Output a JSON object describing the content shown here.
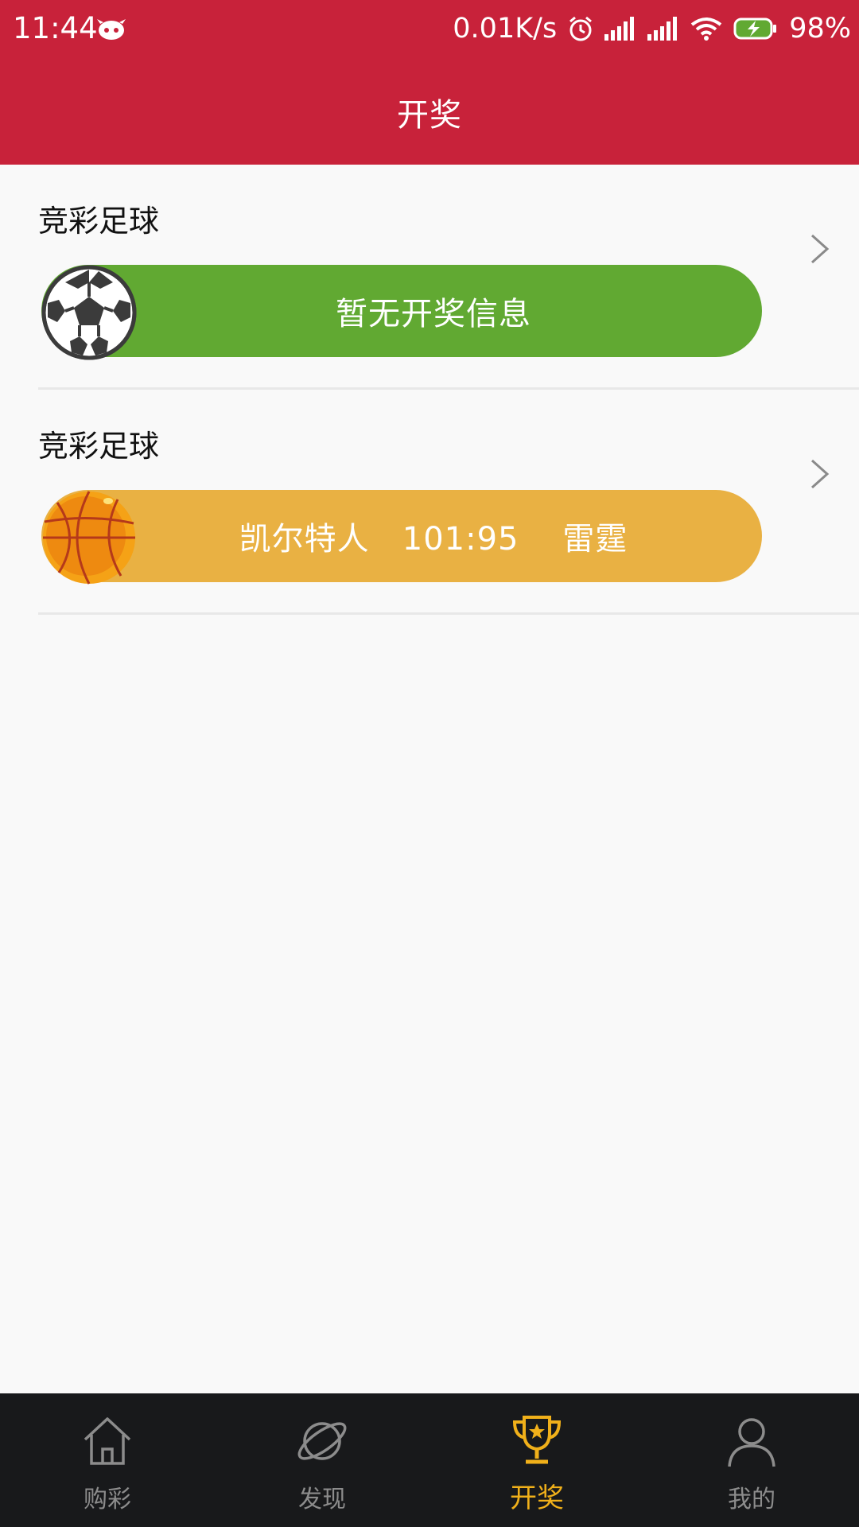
{
  "status_bar": {
    "time": "11:44",
    "net_speed": "0.01K/s",
    "battery": "98%"
  },
  "header": {
    "title": "开奖"
  },
  "results": [
    {
      "title": "竞彩足球",
      "text": "暂无开奖信息",
      "ball": "soccer-ball-icon",
      "color": "#61a932"
    },
    {
      "title": "竞彩足球",
      "text": "凯尔特人   101:95    雷霆",
      "ball": "basketball-icon",
      "color": "#e9b143"
    }
  ],
  "nav": {
    "items": [
      {
        "label": "购彩",
        "icon": "home-icon"
      },
      {
        "label": "发现",
        "icon": "planet-icon"
      },
      {
        "label": "开奖",
        "icon": "trophy-icon",
        "active": true
      },
      {
        "label": "我的",
        "icon": "user-icon"
      }
    ],
    "active_color": "#f0b01a"
  },
  "theme": {
    "brand_red": "#c8223a"
  }
}
